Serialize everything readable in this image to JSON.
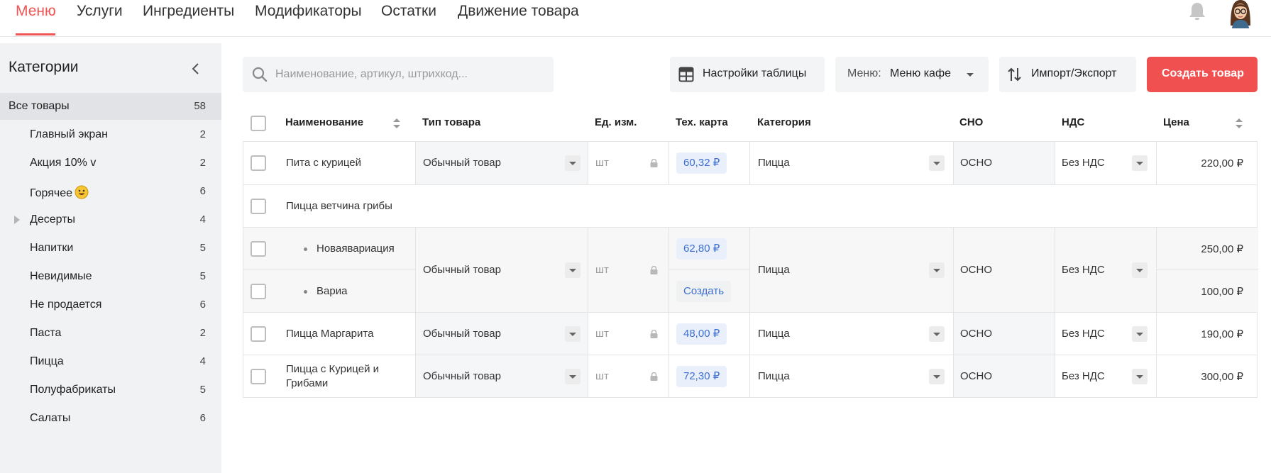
{
  "nav": {
    "tabs": [
      "Меню",
      "Услуги",
      "Ингредиенты",
      "Модификаторы",
      "Остатки",
      "Движение товара"
    ],
    "icons": {
      "bell": "bell-icon",
      "avatar": "user-avatar"
    }
  },
  "sidebar": {
    "title": "Категории",
    "categories": [
      {
        "label": "Все товары",
        "count": "58"
      },
      {
        "label": "Главный экран",
        "count": "2"
      },
      {
        "label": "Акция 10% v",
        "count": "2"
      },
      {
        "label": "Горячее",
        "count": "6"
      },
      {
        "label": "Десерты",
        "count": "4"
      },
      {
        "label": "Напитки",
        "count": "5"
      },
      {
        "label": "Невидимые",
        "count": "5"
      },
      {
        "label": "Не продается",
        "count": "6"
      },
      {
        "label": "Паста",
        "count": "2"
      },
      {
        "label": "Пицца",
        "count": "4"
      },
      {
        "label": "Полуфабрикаты",
        "count": "5"
      },
      {
        "label": "Салаты",
        "count": "6"
      }
    ]
  },
  "toolbar": {
    "search_placeholder": "Наименование, артикул, штрихкод...",
    "table_settings": "Настройки таблицы",
    "menu_label": "Меню:",
    "menu_value": "Меню кафе",
    "import_export": "Импорт/Экспорт",
    "create_product": "Создать товар"
  },
  "table": {
    "headers": {
      "name": "Наименование",
      "type": "Тип товара",
      "unit": "Ед. изм.",
      "techcard": "Тех. карта",
      "category": "Категория",
      "sno": "СНО",
      "nds": "НДС",
      "price": "Цена"
    },
    "rows": [
      {
        "name": "Пита с курицей",
        "type": "Обычный товар",
        "unit": "шт",
        "techcard": "60,32 ₽",
        "category": "Пицца",
        "sno": "ОСНО",
        "nds": "Без НДС",
        "price": "220,00 ₽"
      },
      {
        "name": "Пицца ветчина грибы",
        "type": "Обычный товар",
        "unit": "шт",
        "category": "Пицца",
        "sno": "ОСНО",
        "nds": "Без НДС",
        "variants": [
          {
            "name": "Новаявариация",
            "techcard": "62,80 ₽",
            "price": "250,00 ₽"
          },
          {
            "name": "Вариа",
            "techcard": "Создать",
            "price": "100,00 ₽"
          }
        ]
      },
      {
        "name": "Пицца Маргарита",
        "type": "Обычный товар",
        "unit": "шт",
        "techcard": "48,00 ₽",
        "category": "Пицца",
        "sno": "ОСНО",
        "nds": "Без НДС",
        "price": "190,00 ₽"
      },
      {
        "name_line1": "Пицца с Курицей и",
        "name_line2": "Грибами",
        "type": "Обычный товар",
        "unit": "шт",
        "techcard": "72,30 ₽",
        "category": "Пицца",
        "sno": "ОСНО",
        "nds": "Без НДС",
        "price": "300,00 ₽"
      }
    ]
  },
  "colors": {
    "accent": "#f05454",
    "link": "#3c6fcf",
    "sidebar_bg": "#f1f2f4"
  }
}
